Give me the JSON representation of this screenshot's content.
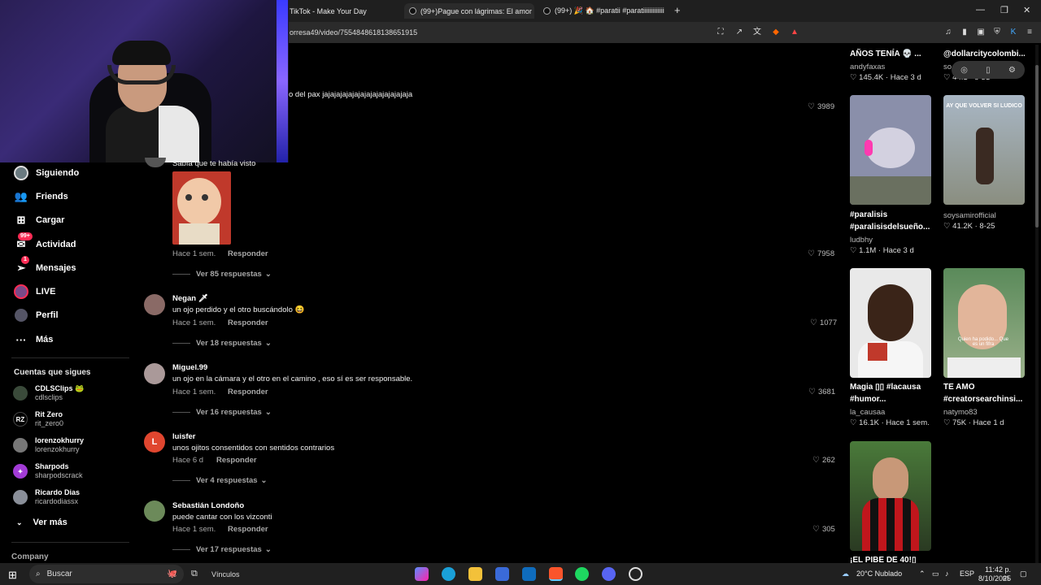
{
  "browser": {
    "tabs": [
      {
        "label": "TikTok - Make Your Day"
      },
      {
        "label": "(99+)Pague con lágrimas: El amor",
        "active": true
      },
      {
        "label": "(99+) 🎉 🏠 #paratii #paratiiiiiiiiiiiii"
      }
    ],
    "url": "orresa49/video/7554848618138651915"
  },
  "sidebar": {
    "items": [
      {
        "label": "Siguiendo",
        "icon": "following-avatar-icon"
      },
      {
        "label": "Friends",
        "icon": "friends-icon"
      },
      {
        "label": "Cargar",
        "icon": "upload-icon"
      },
      {
        "label": "Actividad",
        "icon": "activity-icon",
        "badge": "99+"
      },
      {
        "label": "Mensajes",
        "icon": "messages-icon",
        "badge": "1"
      },
      {
        "label": "LIVE",
        "icon": "live-icon"
      },
      {
        "label": "Perfil",
        "icon": "profile-icon"
      },
      {
        "label": "Más",
        "icon": "more-icon"
      }
    ],
    "following_title": "Cuentas que sigues",
    "following": [
      {
        "name": "CDLSClips 🐸",
        "user": "cdlsclips"
      },
      {
        "name": "Rit Zero",
        "user": "rit_zero0"
      },
      {
        "name": "lorenzokhurry",
        "user": "lorenzokhurry"
      },
      {
        "name": "Sharpods",
        "user": "sharpodscrack"
      },
      {
        "name": "Ricardo Dias",
        "user": "ricardodiassx"
      }
    ],
    "see_more": "Ver más",
    "company": "Company"
  },
  "comments": {
    "top_text": "o del pax jajajajajajajajajajajajajajaja",
    "top_likes": "3989",
    "partial_text": "Sabía que te había visto",
    "items": [
      {
        "user": "",
        "text": "",
        "time": "Hace 1 sem.",
        "reply": "Responder",
        "likes": "7958",
        "view_replies": "Ver 85 respuestas"
      },
      {
        "user": "Negan 🗡",
        "text": "un ojo perdido y el otro buscándolo 😆",
        "time": "Hace 1 sem.",
        "reply": "Responder",
        "likes": "1077",
        "view_replies": "Ver 18 respuestas"
      },
      {
        "user": "Miguel.99",
        "text": "un ojo en la cámara y el otro en el camino , eso sí es ser responsable.",
        "time": "Hace 1 sem.",
        "reply": "Responder",
        "likes": "3681",
        "view_replies": "Ver 16 respuestas"
      },
      {
        "user": "luisfer",
        "text": "unos ojitos consentidos con sentidos contrarios",
        "time": "Hace 6 d",
        "reply": "Responder",
        "likes": "262",
        "view_replies": "Ver 4 respuestas"
      },
      {
        "user": "Sebastián Londoño",
        "text": "puede cantar con los vizconti",
        "time": "Hace 1 sem.",
        "reply": "Responder",
        "likes": "305",
        "view_replies": "Ver 17 respuestas"
      }
    ],
    "avatar_letter_luisfer": "L"
  },
  "videos": {
    "top_left": {
      "title1": "TENÍA ...",
      "title_line": "AÑOS TENÍA 💀 ...",
      "author": "andyfaxas",
      "stats": "♡ 145.4K · Hace 3 d"
    },
    "top_right": {
      "title_line": "@dollarcitycolombi...",
      "author": "so...",
      "stats": "♡ 44.1 · 8-31"
    },
    "items": [
      {
        "title": "#paralisis",
        "title2": "#paralisisdelsueño...",
        "author": "ludbhy",
        "stats": "♡ 1.1M · Hace 3 d",
        "thumb_text": ""
      },
      {
        "title": "soysamirofficial",
        "title2": "",
        "author": "",
        "stats": "♡ 41.2K · 8-25",
        "thumb_text": "AY QUE VOLVER SI LUDICO"
      },
      {
        "title": "Magia ▯▯ #lacausa",
        "title2": "#humor...",
        "author": "la_causaa",
        "stats": "♡ 16.1K · Hace 1 sem.",
        "thumb_text": ""
      },
      {
        "title": "TE AMO",
        "title2": "#creatorsearchinsi...",
        "author": "natymo83",
        "stats": "♡ 75K · Hace 1 d",
        "thumb_text": "Quien ha podido... Que es un fifra"
      },
      {
        "title": "¡EL PIBE DE 40!▯",
        "title2": "",
        "author": "",
        "stats": "",
        "thumb_text": ""
      }
    ]
  },
  "taskbar": {
    "search": "Buscar",
    "links": "Vínculos",
    "weather": "20°C  Nublado",
    "lang": "ESP",
    "time": "11:42 p. m.",
    "date": "8/10/2025"
  },
  "colors": {
    "tiktok_red": "#fe2c55",
    "bg": "#000000",
    "chrome": "#1f1f1f"
  }
}
